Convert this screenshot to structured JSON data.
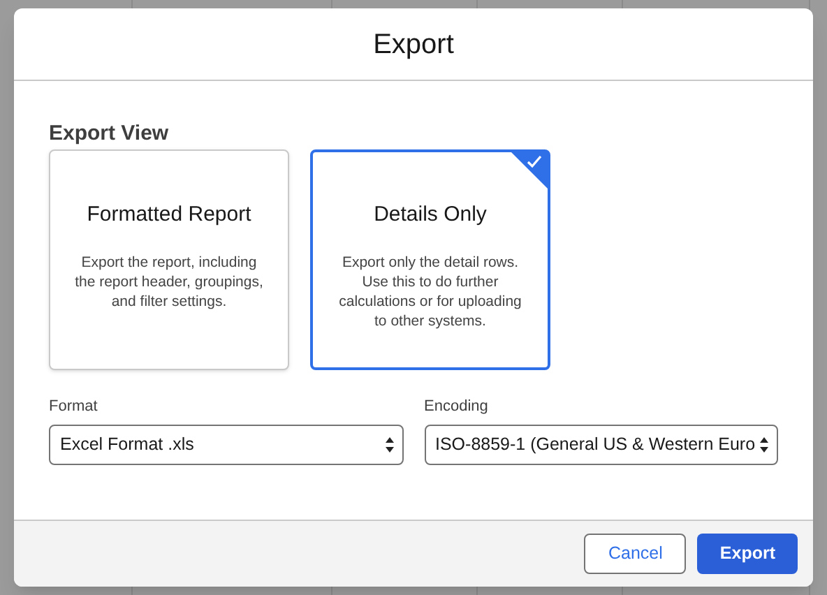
{
  "dialog": {
    "title": "Export"
  },
  "export_view": {
    "label": "Export View",
    "options": [
      {
        "title": "Formatted Report",
        "description": "Export the report, including the report header, groupings, and filter settings.",
        "selected": false
      },
      {
        "title": "Details Only",
        "description": "Export only the detail rows. Use this to do further calculations or for uploading to other systems.",
        "selected": true
      }
    ]
  },
  "fields": [
    {
      "label": "Format",
      "value": "Excel Format .xls"
    },
    {
      "label": "Encoding",
      "value": "ISO-8859-1 (General US & Western Euro"
    }
  ],
  "buttons": [
    {
      "label": "Cancel",
      "kind": "neutral"
    },
    {
      "label": "Export",
      "kind": "brand"
    }
  ]
}
